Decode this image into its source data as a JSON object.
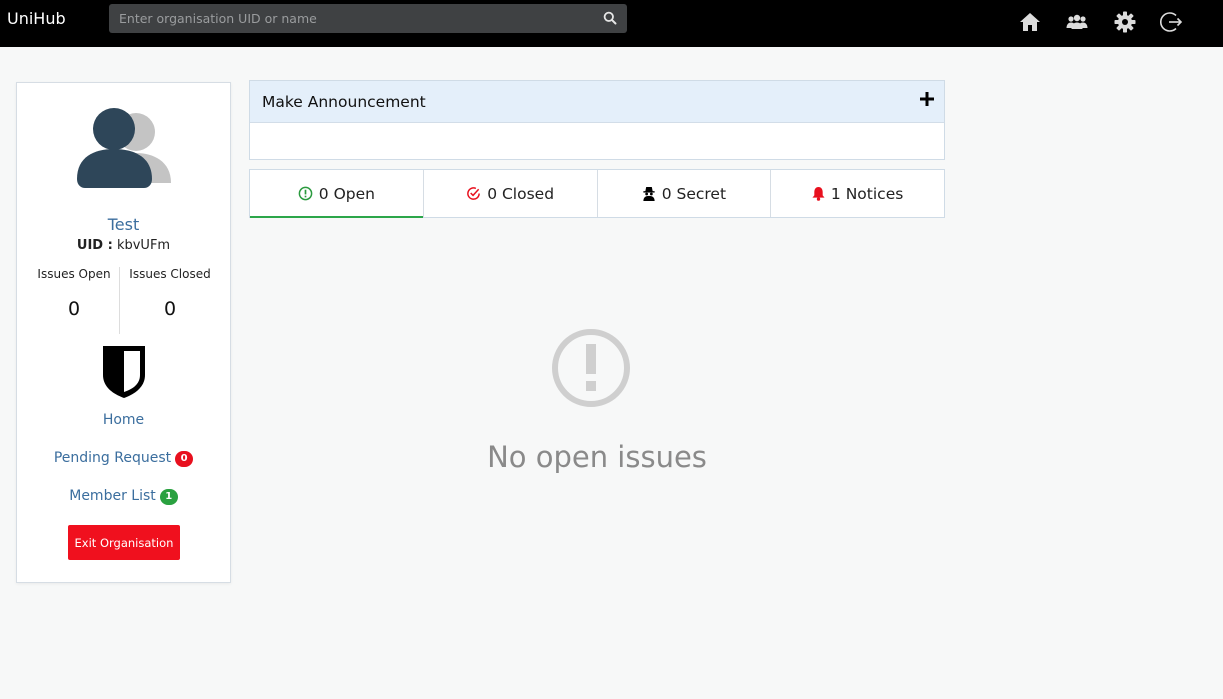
{
  "header": {
    "brand": "UniHub",
    "search_placeholder": "Enter organisation UID or name"
  },
  "nav_icons": [
    "home-icon",
    "members-icon",
    "gear-icon",
    "logout-icon"
  ],
  "profile": {
    "name": "Test",
    "uid_label": "UID :",
    "uid_value": "kbvUFm",
    "issues_open_label": "Issues Open",
    "issues_open_value": "0",
    "issues_closed_label": "Issues Closed",
    "issues_closed_value": "0",
    "links": {
      "home": "Home",
      "pending_request": "Pending Request",
      "pending_count": "0",
      "member_list": "Member List",
      "member_count": "1"
    },
    "exit_button": "Exit Organisation"
  },
  "announcement": {
    "title": "Make Announcement"
  },
  "tabs": [
    {
      "label": "0 Open",
      "icon": "exclamation-circle-icon"
    },
    {
      "label": "0 Closed",
      "icon": "check-circle-icon"
    },
    {
      "label": "0 Secret",
      "icon": "spy-icon"
    },
    {
      "label": "1 Notices",
      "icon": "bell-icon"
    }
  ],
  "empty_state": {
    "message": "No open issues"
  },
  "colors": {
    "topbar": "#000000",
    "link": "#3b6e9e",
    "danger": "#f0101e",
    "success": "#2aa140",
    "announce_header": "#e4effa"
  }
}
